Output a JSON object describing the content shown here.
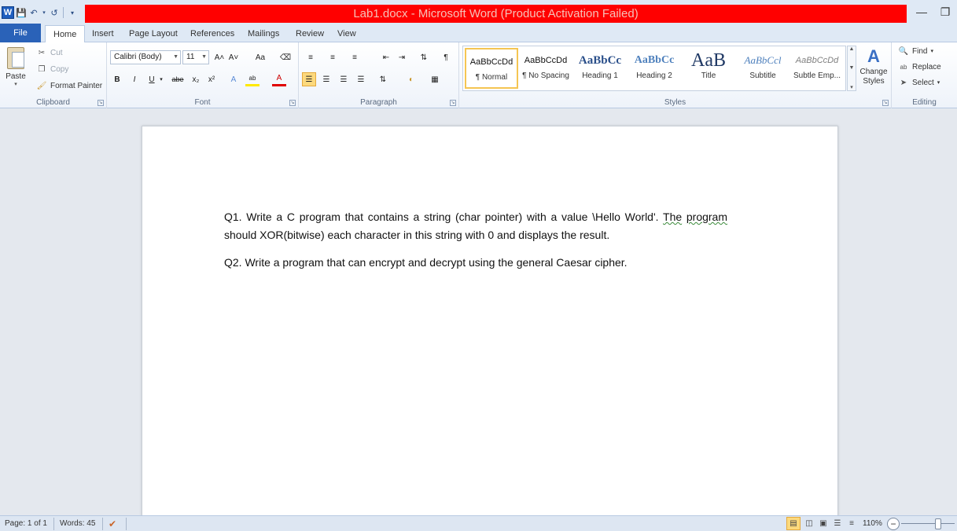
{
  "window": {
    "title": "Lab1.docx - Microsoft Word (Product Activation Failed)",
    "minimize_label": "—",
    "restore_label": "❐"
  },
  "quick_access": {
    "app_icon": "W"
  },
  "tabs": [
    {
      "label": "File"
    },
    {
      "label": "Home"
    },
    {
      "label": "Insert"
    },
    {
      "label": "Page Layout"
    },
    {
      "label": "References"
    },
    {
      "label": "Mailings"
    },
    {
      "label": "Review"
    },
    {
      "label": "View"
    }
  ],
  "clipboard": {
    "paste": "Paste",
    "cut": "Cut",
    "copy": "Copy",
    "format_painter": "Format Painter",
    "group_label": "Clipboard"
  },
  "font": {
    "family": "Calibri (Body)",
    "size": "11",
    "group_label": "Font",
    "grow": "A˄",
    "shrink": "A˅",
    "change_case": "Aa",
    "bold": "B",
    "italic": "I",
    "underline": "U",
    "strike": "abe",
    "subscript": "x₂",
    "superscript": "x²"
  },
  "paragraph": {
    "group_label": "Paragraph",
    "pilcrow": "¶"
  },
  "styles": {
    "group_label": "Styles",
    "items": [
      {
        "preview": "AaBbCcDd",
        "name": "¶ Normal"
      },
      {
        "preview": "AaBbCcDd",
        "name": "¶ No Spacing"
      },
      {
        "preview": "AaBbCc",
        "name": "Heading 1"
      },
      {
        "preview": "AaBbCc",
        "name": "Heading 2"
      },
      {
        "preview": "AaB",
        "name": "Title"
      },
      {
        "preview": "AaBbCcl",
        "name": "Subtitle"
      },
      {
        "preview": "AaBbCcDd",
        "name": "Subtle Emp..."
      }
    ],
    "change_styles": "Change Styles"
  },
  "editing": {
    "group_label": "Editing",
    "find": "Find",
    "replace": "Replace",
    "select": "Select"
  },
  "document": {
    "q1_part1": "Q1. Write a C program that contains a string (char pointer) with a value \\Hello World'. ",
    "q1_flag1": "The",
    "q1_space": " ",
    "q1_flag2": "program",
    "q1_part2": "  should  XOR(bitwise)  each  character in this string with 0 and displays the result.",
    "q2": "Q2. Write a program that can encrypt and decrypt using the general Caesar cipher."
  },
  "status": {
    "page": "Page: 1 of 1",
    "words": "Words: 45",
    "zoom": "110%",
    "zoom_level_percent": 110
  },
  "colors": {
    "title_bar_alert": "#ff0000",
    "file_tab": "#2a62b8",
    "selected_highlight": "#fcd97d"
  }
}
